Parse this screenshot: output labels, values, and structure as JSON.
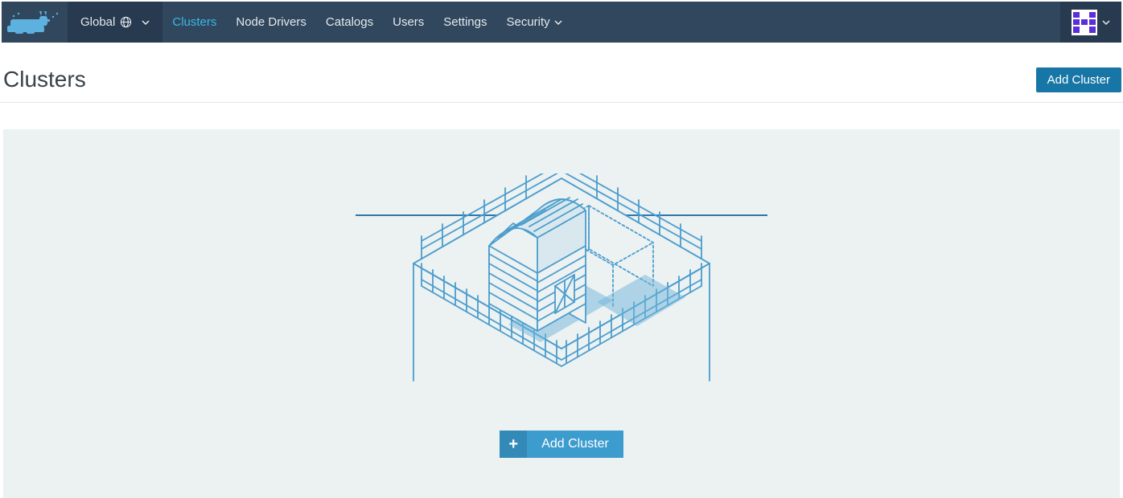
{
  "scope": {
    "label": "Global"
  },
  "nav": {
    "items": [
      {
        "label": "Clusters"
      },
      {
        "label": "Node Drivers"
      },
      {
        "label": "Catalogs"
      },
      {
        "label": "Users"
      },
      {
        "label": "Settings"
      },
      {
        "label": "Security"
      }
    ]
  },
  "page": {
    "title": "Clusters"
  },
  "buttons": {
    "add_cluster_top": "Add Cluster",
    "add_cluster_center": "Add Cluster",
    "plus": "+"
  },
  "colors": {
    "topbar": "#31475e",
    "topbar_dark": "#273a4f",
    "accent_link": "#3bb7e6",
    "primary_button": "#1776a5",
    "center_button_dark": "#338ab7",
    "center_button_light": "#3c9cce",
    "illustration_stroke": "#4b9dcd",
    "empty_bg": "#ecf1f2",
    "avatar_purple": "#5b2fd8"
  }
}
